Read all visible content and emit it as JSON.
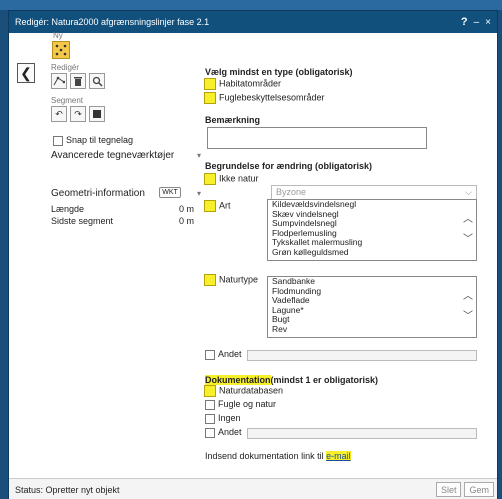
{
  "window": {
    "title": "Redigér: Natura2000 afgrænsningslinjer fase 2.1",
    "help_label": "?",
    "minimize_label": "–",
    "close_label": "×"
  },
  "left": {
    "back_label": "❮",
    "ny_label": "Ny",
    "rediger_label": "Redigér",
    "segment_label": "Segment",
    "snap_label": "Snap til tegnelag",
    "advanced_label": "Avancerede tegneværktøjer",
    "geometry_label": "Geometri-information",
    "wkt_label": "WKT",
    "length_label": "Længde",
    "length_value": "0 m",
    "last_segment_label": "Sidste segment",
    "last_segment_value": "0 m"
  },
  "type_section": {
    "title": "Vælg mindst en type (obligatorisk)",
    "options": [
      "Habitatområder",
      "Fuglebeskyttelsesområder"
    ]
  },
  "remark": {
    "title": "Bemærkning",
    "value": ""
  },
  "reason": {
    "title": "Begrundelse for ændring (obligatorisk)",
    "ikke_natur_label": "Ikke natur",
    "ikke_natur_value": "Byzone",
    "art_label": "Art",
    "art_items": [
      "Kildevældsvindelsnegl",
      "Skæv vindelsnegl",
      "Sumpvindelsnegl",
      "Flodperlemusling",
      "Tykskallet malermusling",
      "Grøn kølleguldsmed"
    ],
    "naturtype_label": "Naturtype",
    "naturtype_items": [
      "Sandbanke",
      "Flodmunding",
      "Vadeflade",
      "Lagune*",
      "Bugt",
      "Rev"
    ],
    "andet_label": "Andet"
  },
  "documentation": {
    "title_main": "Dokumentation",
    "title_rest": "(mindst 1 er obligatorisk)",
    "options": [
      "Naturdatabasen",
      "Fugle og natur",
      "Ingen"
    ],
    "andet_label": "Andet",
    "link_prefix": "Indsend dokumentation link til ",
    "link_text": "e-mail"
  },
  "status": {
    "text": "Status: Opretter nyt objekt",
    "delete_label": "Slet",
    "save_label": "Gem"
  },
  "colors": {
    "highlight": "#f7ef2a",
    "titlebar": "#11507c",
    "ny_button": "#f3c84a"
  }
}
